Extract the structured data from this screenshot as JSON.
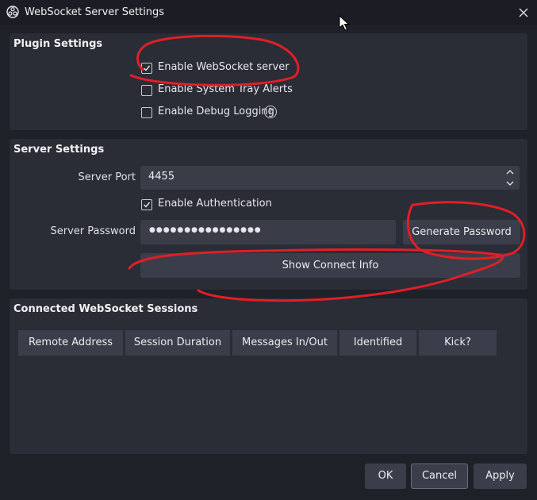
{
  "window": {
    "title": "WebSocket Server Settings",
    "icon": "obs-logo-icon",
    "close_icon": "close-icon"
  },
  "plugin_settings": {
    "title": "Plugin Settings",
    "enable_server": {
      "label": "Enable WebSocket server",
      "checked": true
    },
    "tray_alerts": {
      "label": "Enable System Tray Alerts",
      "checked": false
    },
    "debug_logging": {
      "label": "Enable Debug Logging",
      "checked": false,
      "help_glyph": "?"
    }
  },
  "server_settings": {
    "title": "Server Settings",
    "port_label": "Server Port",
    "port_value": "4455",
    "auth": {
      "label": "Enable Authentication",
      "checked": true
    },
    "password_label": "Server Password",
    "password_masked": "●●●●●●●●●●●●●●●●",
    "generate_button": "Generate Password",
    "connect_info_button": "Show Connect Info"
  },
  "sessions": {
    "title": "Connected WebSocket Sessions",
    "columns": [
      "Remote Address",
      "Session Duration",
      "Messages In/Out",
      "Identified",
      "Kick?"
    ],
    "rows": []
  },
  "footer": {
    "ok": "OK",
    "cancel": "Cancel",
    "apply": "Apply"
  },
  "colors": {
    "background": "#1f2129",
    "panel": "#2a2c36",
    "button": "#3b3e4a",
    "annotation": "#e01f26"
  }
}
